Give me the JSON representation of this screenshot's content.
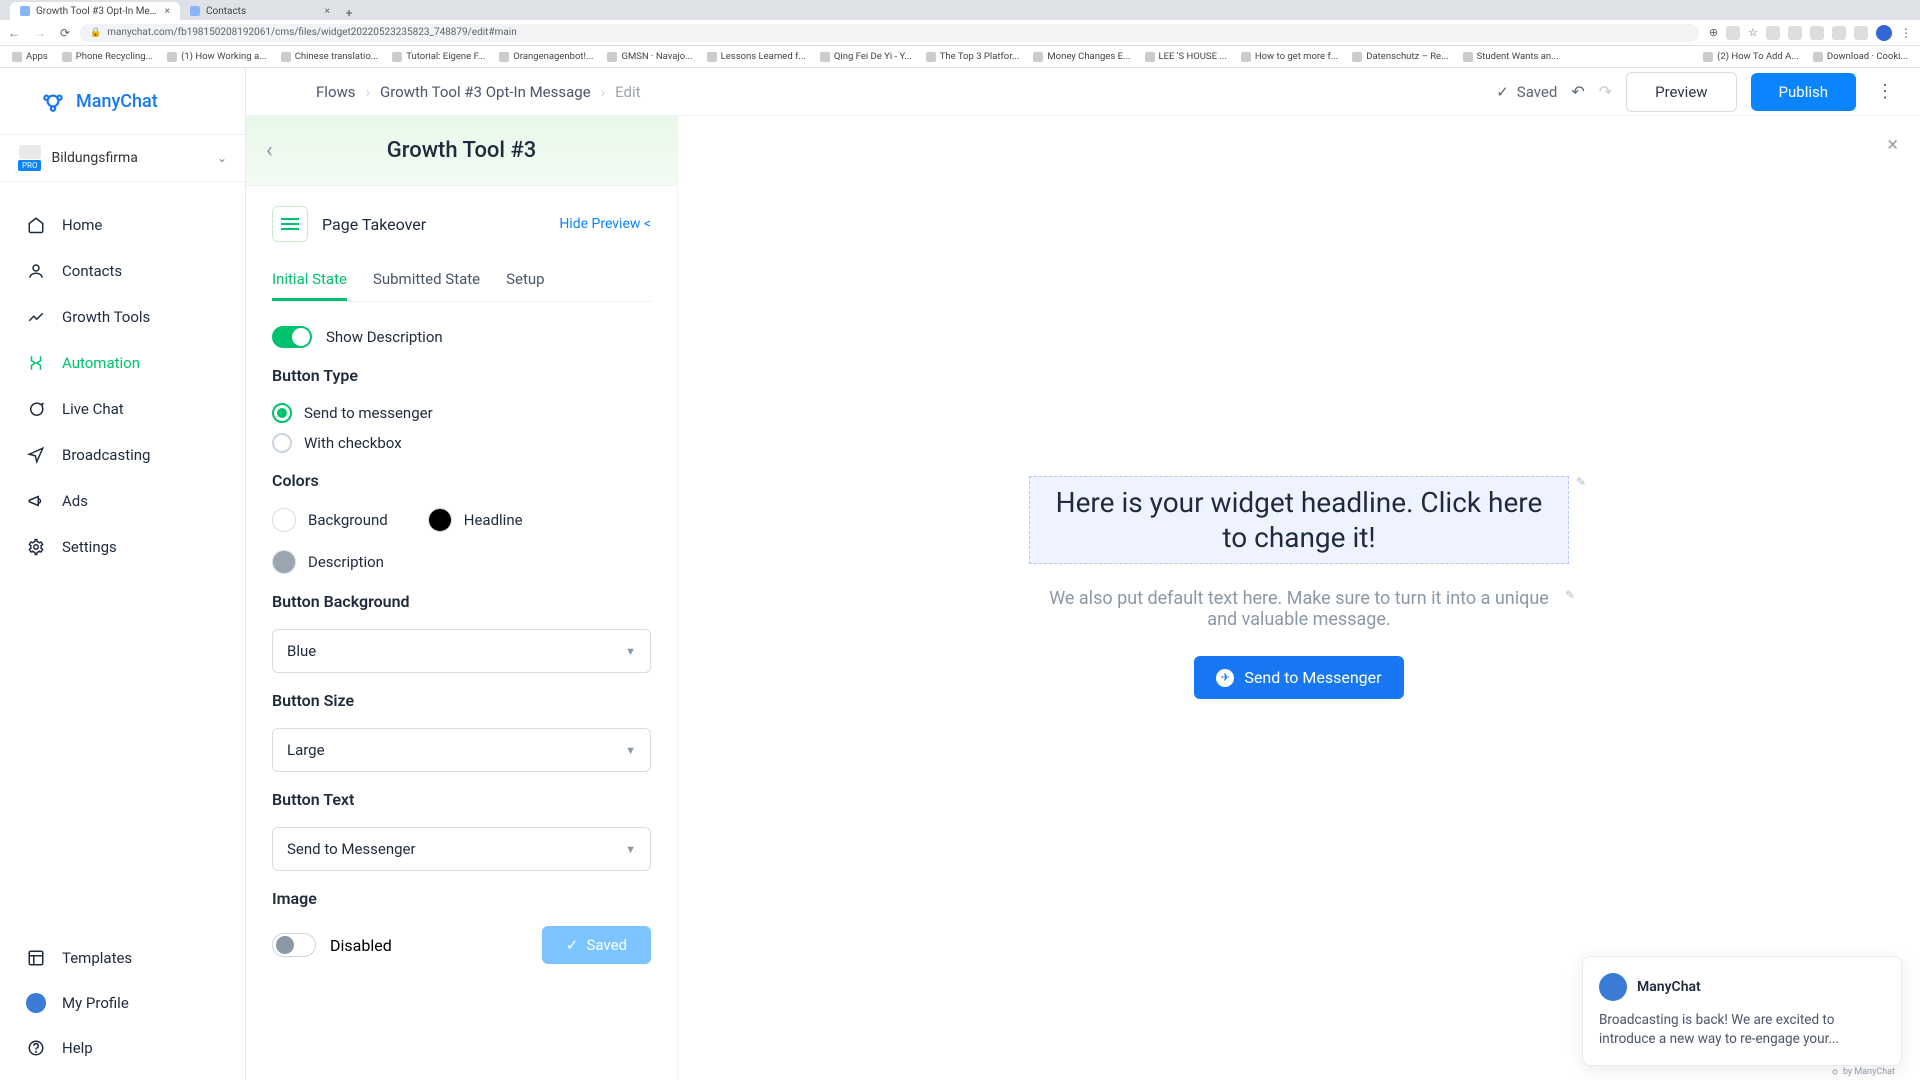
{
  "browser": {
    "tabs": [
      {
        "title": "Growth Tool #3 Opt-In Messa...",
        "active": true
      },
      {
        "title": "Contacts",
        "active": false
      }
    ],
    "url": "manychat.com/fb198150208192061/cms/files/widget20220523235823_748879/edit#main",
    "bookmarks_left": [
      "Apps",
      "Phone Recycling...",
      "(1) How Working a...",
      "Chinese translatio...",
      "Tutorial: Eigene F...",
      "Orangenagenbot!...",
      "GMSN · Navajo...",
      "Lessons Learned f...",
      "Qing Fei De Yi - Y...",
      "The Top 3 Platfor...",
      "Money Changes E...",
      "LEE 'S HOUSE ...",
      "How to get more f...",
      "Datenschutz – Re...",
      "Student Wants an..."
    ],
    "bookmarks_right": [
      "(2) How To Add A...",
      "Download · Cooki..."
    ]
  },
  "brand": {
    "name": "ManyChat"
  },
  "workspace": {
    "name": "Bildungsfirma",
    "badge": "PRO"
  },
  "nav": {
    "home": "Home",
    "contacts": "Contacts",
    "growth": "Growth Tools",
    "automation": "Automation",
    "livechat": "Live Chat",
    "broadcasting": "Broadcasting",
    "ads": "Ads",
    "settings": "Settings",
    "templates": "Templates",
    "profile": "My Profile",
    "help": "Help"
  },
  "header": {
    "crumbs": {
      "flows": "Flows",
      "tool": "Growth Tool #3 Opt-In Message",
      "edit": "Edit"
    },
    "saved": "Saved",
    "preview": "Preview",
    "publish": "Publish"
  },
  "panel": {
    "title": "Growth Tool #3",
    "widget_type": "Page Takeover",
    "hide_preview": "Hide Preview <",
    "tabs": {
      "initial": "Initial State",
      "submitted": "Submitted State",
      "setup": "Setup"
    },
    "show_description": "Show Description",
    "button_type_title": "Button Type",
    "button_type_opts": {
      "send": "Send to messenger",
      "checkbox": "With checkbox"
    },
    "colors_title": "Colors",
    "colors": {
      "background": {
        "label": "Background",
        "hex": "#ffffff"
      },
      "headline": {
        "label": "Headline",
        "hex": "#000000"
      },
      "description": {
        "label": "Description",
        "hex": "#9aa5b1"
      }
    },
    "button_bg_title": "Button Background",
    "button_bg_value": "Blue",
    "button_size_title": "Button Size",
    "button_size_value": "Large",
    "button_text_title": "Button Text",
    "button_text_value": "Send to Messenger",
    "image_title": "Image",
    "image_disabled": "Disabled",
    "saved_btn": "Saved"
  },
  "preview": {
    "headline": "Here is your widget headline. Click here to change it!",
    "description": "We also put default text here. Make sure to turn it into a unique and valuable message.",
    "button": "Send to Messenger"
  },
  "notification": {
    "name": "ManyChat",
    "body": "Broadcasting is back! We are excited to introduce a new way to re-engage your...",
    "tag": "by ManyChat"
  }
}
